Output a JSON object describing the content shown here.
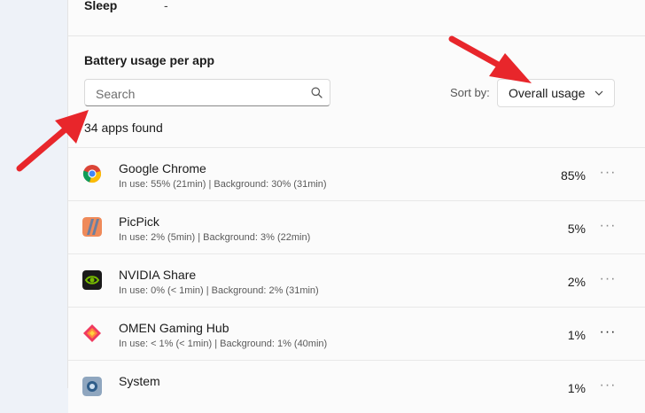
{
  "sleep": {
    "label": "Sleep",
    "value": "-"
  },
  "section": {
    "title": "Battery usage per app"
  },
  "search": {
    "placeholder": "Search",
    "icon": "search-icon"
  },
  "sort": {
    "label": "Sort by:",
    "selected": "Overall usage"
  },
  "apps_found": "34 apps found",
  "apps": [
    {
      "name": "Google Chrome",
      "detail": "In use: 55% (21min) | Background: 30% (31min)",
      "percent": "85%",
      "icon": "chrome-icon"
    },
    {
      "name": "PicPick",
      "detail": "In use: 2% (5min) | Background: 3% (22min)",
      "percent": "5%",
      "icon": "picpick-icon"
    },
    {
      "name": "NVIDIA Share",
      "detail": "In use: 0% (< 1min) | Background: 2% (31min)",
      "percent": "2%",
      "icon": "nvidia-icon"
    },
    {
      "name": "OMEN Gaming Hub",
      "detail": "In use: < 1% (< 1min) | Background: 1% (40min)",
      "percent": "1%",
      "icon": "omen-icon"
    },
    {
      "name": "System",
      "detail": "",
      "percent": "1%",
      "icon": "system-icon"
    }
  ],
  "colors": {
    "annotation_arrow": "#e8262b",
    "accent_text": "#1b1b1b"
  }
}
